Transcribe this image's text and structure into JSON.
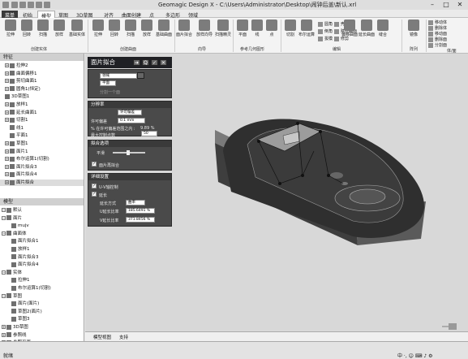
{
  "window": {
    "title": "Geomagic Design X - C:\\Users\\Administrator\\Desktop\\闹钟后盖\\新认.xrl",
    "minimize": "–",
    "maximize": "□",
    "close": "✕"
  },
  "menu": [
    {
      "label": "菜单",
      "state": "file"
    },
    {
      "label": "初始",
      "state": ""
    },
    {
      "label": "模型",
      "state": "active"
    },
    {
      "label": "草图",
      "state": ""
    },
    {
      "label": "3D草图",
      "state": ""
    },
    {
      "label": "对齐",
      "state": ""
    },
    {
      "label": "曲面创建",
      "state": ""
    },
    {
      "label": "点",
      "state": ""
    },
    {
      "label": "多边形",
      "state": ""
    },
    {
      "label": "领域",
      "state": ""
    }
  ],
  "ribbon": {
    "create_solid": {
      "label": "创建实体",
      "buttons": [
        "拉伸",
        "回转",
        "扫描",
        "放样",
        "基础实体"
      ]
    },
    "create_surface": {
      "label": "创建曲面",
      "buttons": [
        "拉伸",
        "回转",
        "扫描",
        "放样",
        "基础曲面"
      ]
    },
    "wizard": {
      "label": "向导",
      "buttons": [
        "面片拟合",
        "放样向导",
        "扫描精灵"
      ]
    },
    "ref_geometry": {
      "label": "参考几何图形",
      "buttons": [
        "平面",
        "线",
        "点"
      ]
    },
    "edit": {
      "label": "编辑",
      "buttons": [
        "切割",
        "布尔运算",
        "圆角",
        "倒角",
        "拔模",
        "壳体",
        "赋厚曲面",
        "修剪",
        "延长曲面",
        "缝合",
        "偏移曲面"
      ]
    },
    "array": {
      "label": "阵列",
      "buttons": [
        "镜像"
      ]
    },
    "body_face": {
      "label": "体/面",
      "buttons": [
        "移动体",
        "删除体",
        "移动面",
        "删除面",
        "分割面"
      ]
    }
  },
  "left_panel": {
    "header": "特征",
    "features": [
      {
        "toggle": "+",
        "label": "拉伸2",
        "selected": false,
        "grey": false,
        "x": 6
      },
      {
        "toggle": "+",
        "label": "曲面偏移1",
        "selected": false,
        "grey": false,
        "x": 6
      },
      {
        "toggle": "+",
        "label": "剪切曲面1",
        "selected": false,
        "grey": false,
        "x": 6
      },
      {
        "toggle": "+",
        "label": "圆角1(恒定)",
        "selected": false,
        "grey": false,
        "x": 6
      },
      {
        "toggle": "",
        "label": "3D草图1",
        "selected": false,
        "grey": false,
        "x": 6
      },
      {
        "toggle": "+",
        "label": "放样1",
        "selected": false,
        "grey": false,
        "x": 6
      },
      {
        "toggle": "+",
        "label": "延长曲面1",
        "selected": false,
        "grey": false,
        "x": 6
      },
      {
        "toggle": "+",
        "label": "切割1",
        "selected": false,
        "grey": false,
        "x": 6
      },
      {
        "toggle": "",
        "label": "线1",
        "selected": false,
        "grey": false,
        "x": 12
      },
      {
        "toggle": "",
        "label": "平面1",
        "selected": false,
        "grey": false,
        "x": 12
      },
      {
        "toggle": "+",
        "label": "草图1",
        "selected": false,
        "grey": false,
        "x": 6
      },
      {
        "toggle": "+",
        "label": "面片1",
        "selected": false,
        "grey": false,
        "x": 6
      },
      {
        "toggle": "+",
        "label": "布尔运算1(切割)",
        "selected": false,
        "grey": false,
        "x": 6
      },
      {
        "toggle": "+",
        "label": "面片拟合3",
        "selected": false,
        "grey": false,
        "x": 6
      },
      {
        "toggle": "+",
        "label": "面片拟合4",
        "selected": false,
        "grey": false,
        "x": 6
      },
      {
        "toggle": "+",
        "label": "面片拟合",
        "selected": true,
        "grey": false,
        "x": 6
      }
    ],
    "model_header": "模型",
    "model": [
      {
        "toggle": "−",
        "label": "默认",
        "selected": false,
        "grey": false,
        "x": 2
      },
      {
        "toggle": "−",
        "label": "面片",
        "selected": false,
        "grey": false,
        "x": 2
      },
      {
        "toggle": "",
        "label": "mujv",
        "selected": false,
        "grey": false,
        "x": 14
      },
      {
        "toggle": "−",
        "label": "曲面体",
        "selected": false,
        "grey": false,
        "x": 2
      },
      {
        "toggle": "",
        "label": "面片拟合1",
        "selected": false,
        "grey": false,
        "x": 14
      },
      {
        "toggle": "",
        "label": "放样1",
        "selected": false,
        "grey": false,
        "x": 14
      },
      {
        "toggle": "",
        "label": "面片拟合3",
        "selected": false,
        "grey": false,
        "x": 14
      },
      {
        "toggle": "",
        "label": "面片拟合4",
        "selected": false,
        "grey": false,
        "x": 14
      },
      {
        "toggle": "−",
        "label": "实体",
        "selected": false,
        "grey": false,
        "x": 2
      },
      {
        "toggle": "",
        "label": "拉伸1",
        "selected": false,
        "grey": false,
        "x": 14
      },
      {
        "toggle": "",
        "label": "布尔运算1(切割)",
        "selected": false,
        "grey": false,
        "x": 14
      },
      {
        "toggle": "−",
        "label": "草图",
        "selected": false,
        "grey": false,
        "x": 2
      },
      {
        "toggle": "",
        "label": "面片(面片)",
        "selected": false,
        "grey": false,
        "x": 14
      },
      {
        "toggle": "",
        "label": "草图2(面片)",
        "selected": false,
        "grey": false,
        "x": 14
      },
      {
        "toggle": "",
        "label": "草图3",
        "selected": false,
        "grey": false,
        "x": 14
      },
      {
        "toggle": "+",
        "label": "3D草图",
        "selected": false,
        "grey": false,
        "x": 2
      },
      {
        "toggle": "+",
        "label": "参照线",
        "selected": false,
        "grey": false,
        "x": 2
      },
      {
        "toggle": "+",
        "label": "参照平面",
        "selected": false,
        "grey": false,
        "x": 2
      }
    ]
  },
  "dialog": {
    "title": "面片拟合",
    "buttons": [
      "➜",
      "Q",
      "✓",
      "✕"
    ],
    "field": "领域",
    "sub_label": "平面",
    "ghost": "分割一个面",
    "resolution": {
      "title": "分辨率",
      "mode": "许可偏差",
      "allowable_label": "许可偏差",
      "allowable_value": "0.1 mm",
      "percent_label": "% 在许可偏差范围之内 :",
      "percent_value": "9.89 %",
      "max_ctrl_label": "最大控制点数",
      "max_ctrl_value": "50"
    },
    "smooth": {
      "title": "拟合选项",
      "smooth_label": "平滑",
      "check": "面片再拟合"
    },
    "detail": {
      "title": "详细设置",
      "uv_check": "U-V轴控制",
      "extend_check": "延长",
      "extend_method_label": "延长方式",
      "extend_method_value": "曲率",
      "u_label": "U延长比率",
      "u_value": "185.6491 %",
      "v_label": "V延长比率",
      "v_value": "371.8456 %"
    }
  },
  "bottom_tabs": [
    "模型视图",
    "支持"
  ],
  "status": {
    "left": "就绪",
    "ime": "中 ·, ☺ ⌨ ♪ ⚙"
  },
  "colors": {
    "panel_header": "#1f2024",
    "panel_bg": "#4a4a4a",
    "viewport": "#d8d8d8"
  }
}
